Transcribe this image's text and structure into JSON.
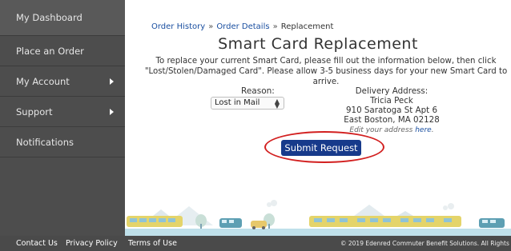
{
  "sidebar": {
    "items": [
      {
        "label": "My Dashboard"
      },
      {
        "label": "Place an Order"
      },
      {
        "label": "My Account"
      },
      {
        "label": "Support"
      },
      {
        "label": "Notifications"
      }
    ]
  },
  "breadcrumb": {
    "order_history": "Order History",
    "separator": "»",
    "order_details": "Order Details",
    "current": "Replacement"
  },
  "page": {
    "title": "Smart Card Replacement",
    "instructions_line1": "To replace your current Smart Card, please fill out the information below, then click",
    "instructions_line2": "\"Lost/Stolen/Damaged Card\". Please allow 3-5 business days for your new Smart Card to arrive."
  },
  "reason": {
    "label": "Reason:",
    "selected": "Lost in Mail",
    "arrow": "▲▼"
  },
  "delivery": {
    "label": "Delivery Address:",
    "name": "Tricia Peck",
    "street": "910 Saratoga St Apt 6",
    "city": "East Boston, MA 02128",
    "edit_prefix": "Edit your address ",
    "edit_link": "here",
    "edit_suffix": "."
  },
  "submit": {
    "label": "Submit Request"
  },
  "footer": {
    "contact": "Contact Us",
    "privacy": "Privacy Policy",
    "terms": "Terms of Use",
    "copyright": "© 2019 Edenred Commuter Benefit Solutions. All Rights Reser"
  },
  "colors": {
    "sidebar_bg": "#4d4d4d",
    "link": "#1a4fa0",
    "submit_bg": "#173a8b",
    "highlight_circle": "#d21f1f",
    "footer_bg": "#4a4a4a"
  }
}
